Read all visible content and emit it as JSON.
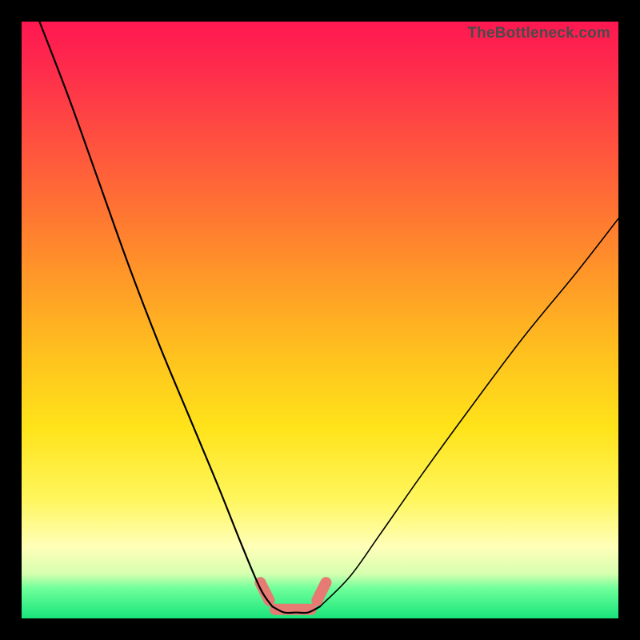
{
  "watermark": "TheBottleneck.com",
  "colors": {
    "frame": "#000000",
    "gradient_top": "#ff1751",
    "gradient_mid": "#ffe31a",
    "gradient_bottom": "#18e47a",
    "curve": "#000000",
    "floor_mark": "#e87a74"
  },
  "chart_data": {
    "type": "line",
    "title": "",
    "xlabel": "",
    "ylabel": "",
    "xlim": [
      0,
      100
    ],
    "ylim": [
      0,
      100
    ],
    "annotations": [
      "TheBottleneck.com"
    ],
    "series": [
      {
        "name": "left-branch",
        "x": [
          3,
          8,
          13,
          18,
          23,
          28,
          33,
          37,
          40,
          42
        ],
        "y": [
          100,
          87,
          73,
          59,
          46,
          34,
          22,
          12,
          5,
          2
        ]
      },
      {
        "name": "valley-floor",
        "x": [
          42,
          44,
          46,
          48,
          50
        ],
        "y": [
          2,
          1,
          1,
          1,
          2
        ]
      },
      {
        "name": "right-branch",
        "x": [
          50,
          55,
          60,
          67,
          75,
          84,
          93,
          100
        ],
        "y": [
          2,
          7,
          14,
          24,
          35,
          47,
          58,
          67
        ]
      }
    ],
    "floor_marks": {
      "name": "valley-floor-highlight",
      "color": "#e87a74",
      "segments": [
        {
          "x": [
            40.0,
            41.5
          ],
          "y": [
            6,
            3
          ]
        },
        {
          "x": [
            42.5,
            48.5
          ],
          "y": [
            1.5,
            1.5
          ]
        },
        {
          "x": [
            49.5,
            51.0
          ],
          "y": [
            3,
            6
          ]
        }
      ]
    }
  }
}
